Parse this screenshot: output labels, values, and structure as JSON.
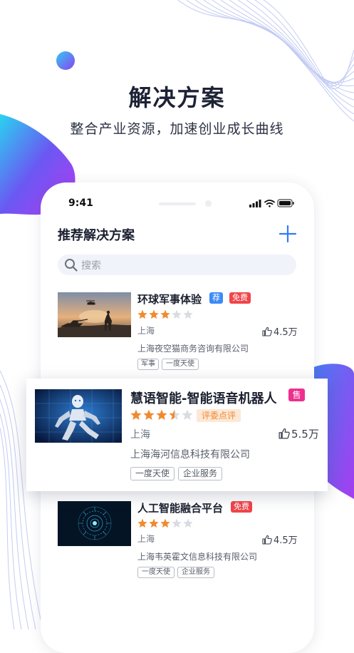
{
  "headline": {
    "title": "解决方案",
    "subtitle": "整合产业资源，加速创业成长曲线"
  },
  "status_bar": {
    "time": "9:41"
  },
  "page": {
    "title": "推荐解决方案",
    "search_placeholder": "搜索"
  },
  "items": [
    {
      "title": "环球军事体验",
      "badges": [
        "荐",
        "免费"
      ],
      "rating": 3,
      "city": "上海",
      "likes": "4.5万",
      "company": "上海夜空猫商务咨询有限公司",
      "tags": [
        "军事",
        "一度天使"
      ]
    },
    {
      "title": "慧语智能-智能语音机器人",
      "badges": [
        "售"
      ],
      "rating": 3.5,
      "rating_note": "评委点评",
      "city": "上海",
      "likes": "5.5万",
      "company": "上海海河信息科技有限公司",
      "tags": [
        "一度天使",
        "企业服务"
      ]
    },
    {
      "title": "人工智能融合平台",
      "badges": [
        "免费"
      ],
      "rating": 3,
      "city": "上海",
      "likes": "4.5万",
      "company": "上海韦英霍文信息科技有限公司",
      "tags": [
        "一度天使",
        "企业服务"
      ]
    }
  ],
  "colors": {
    "badge_recommend": "#3d8af7",
    "badge_free": "#f0454a",
    "badge_sale": "#ee2f8f",
    "star_on": "#f08a30",
    "star_off": "#d9dce2",
    "accent_blue": "#2e7cf6"
  }
}
